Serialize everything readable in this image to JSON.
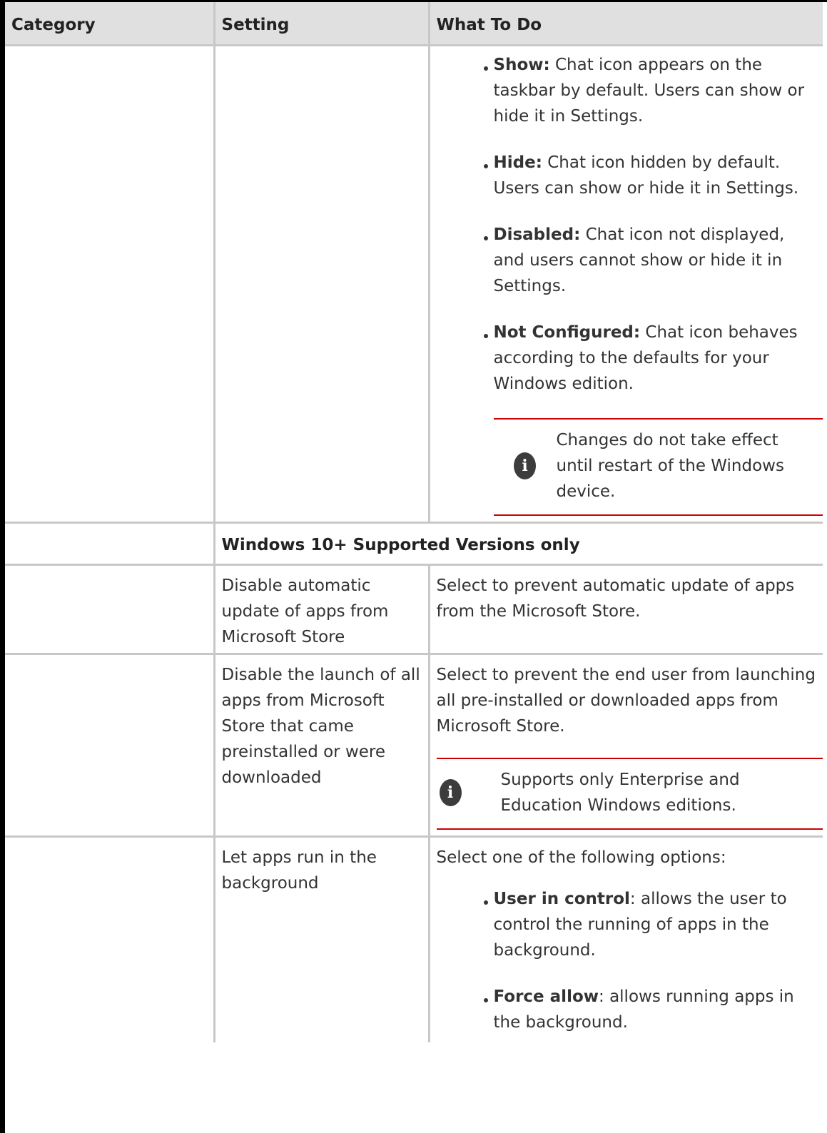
{
  "table": {
    "headers": [
      "Category",
      "Setting",
      "What To Do"
    ],
    "chat_options": [
      {
        "label": "Show:",
        "text": " Chat icon appears on the taskbar by default. Users can show or hide it in Settings."
      },
      {
        "label": "Hide:",
        "text": " Chat icon hidden by default. Users can show or hide it in Settings."
      },
      {
        "label": "Disabled:",
        "text": " Chat icon not displayed, and users cannot show or hide it in Settings."
      },
      {
        "label": "Not Configured:",
        "text": " Chat icon behaves according to the defaults for your Windows edition."
      }
    ],
    "chat_note": "Changes do not take effect until restart of the Windows device.",
    "section_heading": "Windows 10+ Supported Versions only",
    "rows": [
      {
        "setting": "Disable automatic update of apps from Microsoft Store",
        "what": "Select to prevent automatic update of apps from the Microsoft Store."
      },
      {
        "setting": "Disable the launch of all apps from Microsoft Store that came preinstalled or were downloaded",
        "what": "Select to prevent the end user from launching all pre-installed or downloaded apps from Microsoft Store.",
        "note": "Supports only Enterprise and Education Windows editions."
      },
      {
        "setting": "Let apps run in the background",
        "what": "Select one of the following options:",
        "options": [
          {
            "label": "User in control",
            "text": ": allows the user to control the running of apps in the background."
          },
          {
            "label": "Force allow",
            "text": ": allows running apps in the background."
          }
        ]
      }
    ]
  }
}
